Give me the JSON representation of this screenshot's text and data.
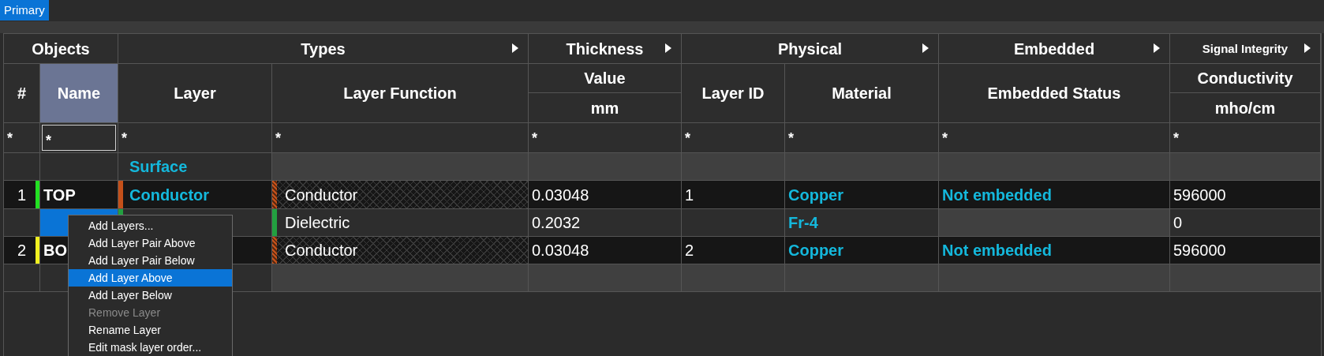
{
  "tabs": [
    {
      "label": "Primary",
      "selected": true
    }
  ],
  "table": {
    "groups": [
      {
        "title": "Objects",
        "expandable": false,
        "columns": [
          {
            "title": "#",
            "selected": false
          },
          {
            "title": "Name",
            "selected": true
          }
        ]
      },
      {
        "title": "Types",
        "expandable": true,
        "columns": [
          {
            "title": "Layer",
            "selected": false
          },
          {
            "title": "Layer Function",
            "selected": false
          }
        ]
      },
      {
        "title": "Thickness",
        "expandable": true,
        "columns": [
          {
            "title": "Value",
            "unit": "mm",
            "selected": false
          }
        ]
      },
      {
        "title": "Physical",
        "expandable": true,
        "columns": [
          {
            "title": "Layer ID",
            "selected": false
          },
          {
            "title": "Material",
            "selected": false
          }
        ]
      },
      {
        "title": "Embedded",
        "expandable": true,
        "columns": [
          {
            "title": "Embedded Status",
            "selected": false
          }
        ]
      },
      {
        "title": "Signal Integrity",
        "expandable": true,
        "columns": [
          {
            "title": "Conductivity",
            "unit": "mho/cm",
            "selected": false
          }
        ]
      }
    ],
    "filters": [
      {
        "text": "*",
        "focused": false
      },
      {
        "text": "*",
        "focused": true
      },
      {
        "text": "*",
        "focused": false
      },
      {
        "text": "*",
        "focused": false
      },
      {
        "text": "*",
        "focused": false
      },
      {
        "text": "*",
        "focused": false
      },
      {
        "text": "*",
        "focused": false
      },
      {
        "text": "*",
        "focused": false
      },
      {
        "text": "*",
        "focused": false
      }
    ],
    "rows": [
      {
        "kind": "group",
        "label": "Surface"
      },
      {
        "kind": "conductor",
        "number": "1",
        "name": "TOP",
        "color": "#22e022",
        "layer": {
          "text": "Conductor",
          "color": "#c4501a"
        },
        "function": "Conductor",
        "thickness": "0.03048",
        "layer_id": "1",
        "material": "Copper",
        "embedded": "Not embedded",
        "conductivity": "596000",
        "selected": false
      },
      {
        "kind": "dielectric",
        "layer": {
          "color": "#22a040"
        },
        "function": "Dielectric",
        "thickness": "0.2032",
        "material": "Fr-4",
        "conductivity": "0",
        "selected": true
      },
      {
        "kind": "conductor",
        "number": "2",
        "name": "BO",
        "color": "#f0f020",
        "function": "Conductor",
        "thickness": "0.03048",
        "layer_id": "2",
        "material": "Copper",
        "embedded": "Not embedded",
        "conductivity": "596000",
        "selected": false
      },
      {
        "kind": "empty"
      }
    ]
  },
  "context_menu": {
    "items": [
      {
        "label": "Add Layers...",
        "disabled": false,
        "selected": false
      },
      {
        "label": "Add Layer Pair Above",
        "disabled": false,
        "selected": false
      },
      {
        "label": "Add Layer Pair Below",
        "disabled": false,
        "selected": false
      },
      {
        "label": "Add Layer Above",
        "disabled": false,
        "selected": true
      },
      {
        "label": "Add Layer Below",
        "disabled": false,
        "selected": false
      },
      {
        "label": "Remove Layer",
        "disabled": true,
        "selected": false
      },
      {
        "label": "Rename Layer",
        "disabled": false,
        "selected": false
      },
      {
        "label": "Edit mask layer order...",
        "disabled": false,
        "selected": false
      }
    ]
  }
}
